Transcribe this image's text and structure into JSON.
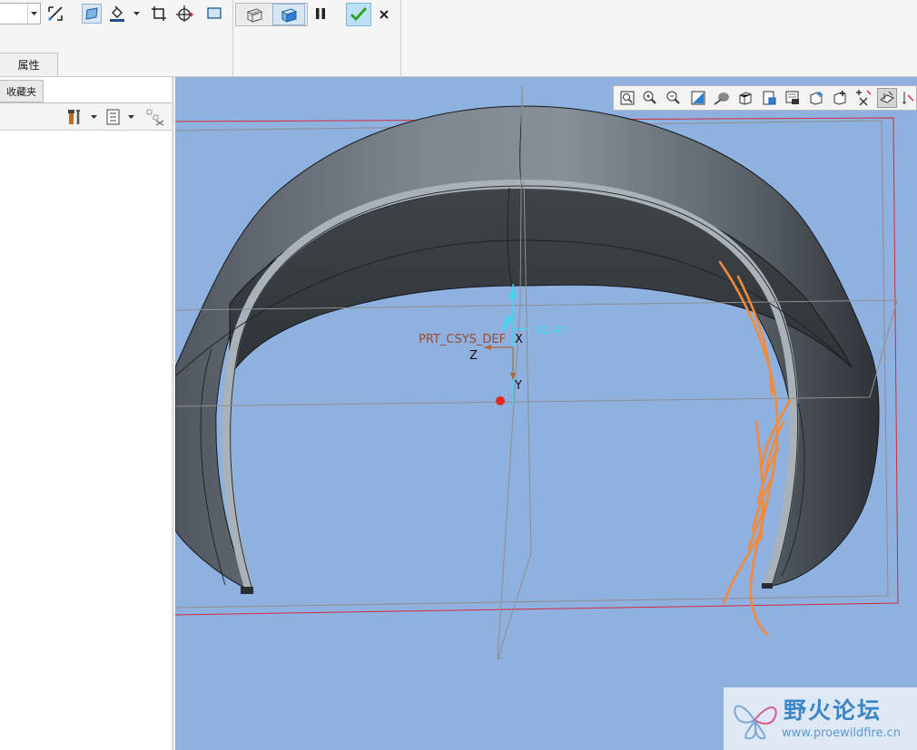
{
  "ribbon": {
    "tab_properties": "属性",
    "combo_value": ""
  },
  "left_panel": {
    "tab_favorites": "收藏夹"
  },
  "viewport": {
    "csys_label": "PRT_CSYS_DEF",
    "axis_x": "X",
    "axis_y": "Y",
    "axis_z": "Z",
    "dimension_value": "82.40"
  },
  "watermark": {
    "title": "野火论坛",
    "url": "www.proewildfire.cn"
  },
  "colors": {
    "viewport_bg": "#8fb1df",
    "datum_orange": "#f28a3c",
    "csys_cyan": "#3fd8f0",
    "accept_green": "#2aa52a",
    "boundary_red": "#d6283c"
  },
  "icons": [
    "datum-line-icon",
    "surface-icon",
    "color-fill-icon",
    "crop-icon",
    "csys-icon",
    "rectangle-icon",
    "wireframe-preview-icon",
    "solid-preview-icon",
    "pause-icon",
    "accept-check-icon",
    "cancel-x-icon",
    "tool-icon",
    "list-view-icon",
    "tree-filter-icon",
    "refit-icon",
    "zoom-in-icon",
    "zoom-out-icon",
    "repaint-icon",
    "shaded-icon",
    "view-box-icon",
    "saved-views-icon",
    "camera-icon",
    "datum-display-icon",
    "annotation-icon",
    "spin-center-icon",
    "sketch-view-icon"
  ]
}
